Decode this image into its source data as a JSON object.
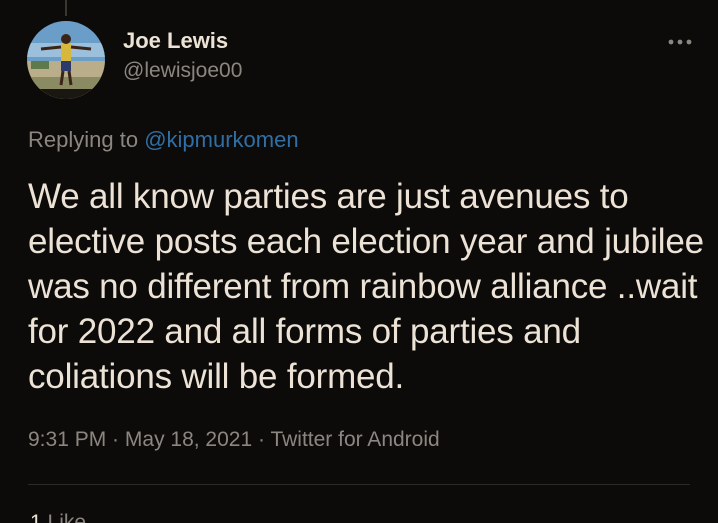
{
  "tweet": {
    "author": {
      "display_name": "Joe Lewis",
      "handle": "@lewisjoe00",
      "avatar_icon": "avatar-photo"
    },
    "more_icon": "more-options-icon",
    "reply": {
      "prefix": "Replying to ",
      "mention": "@kipmurkomen"
    },
    "text": "We all know parties are just avenues to elective posts each election year and jubilee was no different from rainbow alliance ..wait for 2022 and all forms of parties and coliations will be formed.",
    "meta": {
      "time": "9:31 PM",
      "date": "May 18, 2021",
      "source": "Twitter for Android",
      "separator": " · "
    },
    "stats": {
      "likes_count": "1",
      "likes_label": "Like"
    }
  },
  "colors": {
    "background": "#0d0b0a",
    "text_primary": "#ece3d6",
    "text_secondary": "#8b8680",
    "link": "#2f6fa6"
  }
}
